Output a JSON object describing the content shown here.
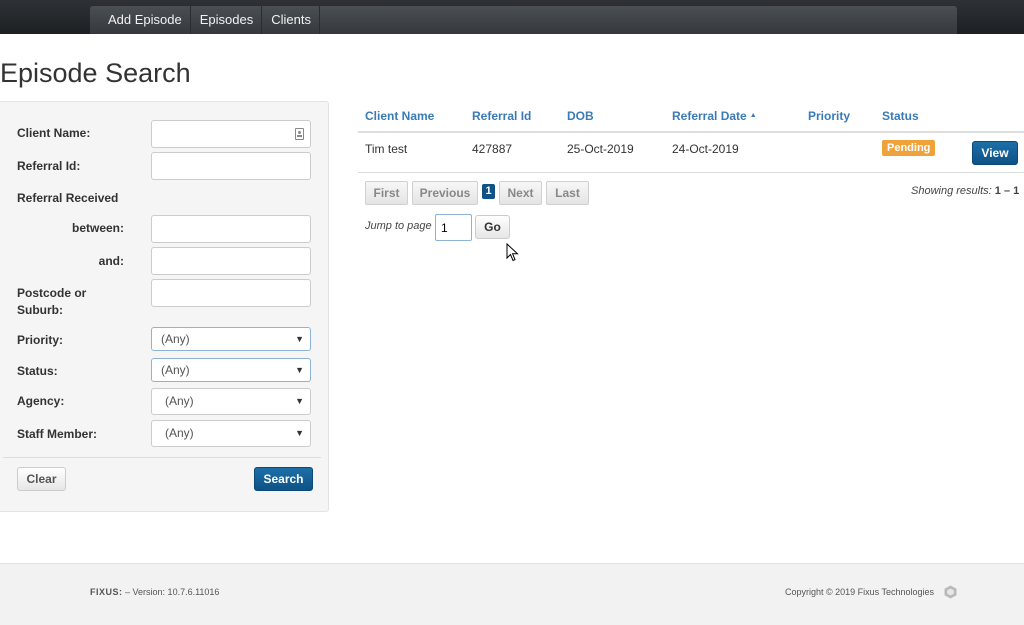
{
  "nav": {
    "items": [
      "Add Episode",
      "Episodes",
      "Clients"
    ]
  },
  "page": {
    "title": "Episode Search"
  },
  "search_form": {
    "client_name_label": "Client Name:",
    "client_name_value": "",
    "referral_id_label": "Referral Id:",
    "referral_id_value": "",
    "referral_received_label": "Referral Received",
    "between_label": "between:",
    "between_value": "",
    "and_label": "and:",
    "and_value": "",
    "postcode_label_line1": "Postcode or",
    "postcode_label_line2": "Suburb:",
    "postcode_value": "",
    "priority_label": "Priority:",
    "priority_value": "(Any)",
    "status_label": "Status:",
    "status_value": "(Any)",
    "agency_label": "Agency:",
    "agency_value": "(Any)",
    "staff_label": "Staff Member:",
    "staff_value": "(Any)",
    "clear_label": "Clear",
    "search_label": "Search"
  },
  "results": {
    "columns": [
      "Client Name",
      "Referral Id",
      "DOB",
      "Referral Date",
      "Priority",
      "Status"
    ],
    "sorted_column": "Referral Date",
    "rows": [
      {
        "client_name": "Tim test",
        "referral_id": "427887",
        "dob": "25-Oct-2019",
        "referral_date": "24-Oct-2019",
        "priority": "",
        "status": "Pending",
        "action_label": "View"
      }
    ]
  },
  "pagination": {
    "first_label": "First",
    "previous_label": "Previous",
    "current_page": "1",
    "next_label": "Next",
    "last_label": "Last",
    "showing_prefix": "Showing results:",
    "showing_range": "1 – 1",
    "jump_label": "Jump to page",
    "jump_value": "1",
    "go_label": "Go"
  },
  "footer": {
    "brand": "FIXUS:",
    "version_text": "– Version: 10.7.6.11016",
    "copyright": "Copyright © 2019 Fixus Technologies"
  },
  "colors": {
    "nav_bg": "#3f4449",
    "link_blue": "#3a7bb5",
    "primary_button": "#0e5286",
    "pending_badge": "#f0a23a"
  },
  "icons": {
    "client_lookup": "contact-card-icon",
    "select_caret": "caret-down-icon",
    "sort": "sort-ascending-icon",
    "cursor": "mouse-pointer-icon",
    "footer_logo": "fixus-logo-icon"
  }
}
